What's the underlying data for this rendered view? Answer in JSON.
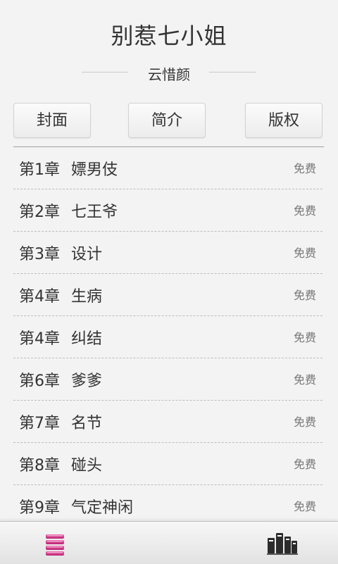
{
  "book": {
    "title": "别惹七小姐",
    "author": "云惜颜"
  },
  "buttons": {
    "cover": "封面",
    "intro": "简介",
    "copyright": "版权"
  },
  "chapters": [
    {
      "number": "第1章",
      "name": "嫖男伎",
      "price": "免费"
    },
    {
      "number": "第2章",
      "name": "七王爷",
      "price": "免费"
    },
    {
      "number": "第3章",
      "name": "设计",
      "price": "免费"
    },
    {
      "number": "第4章",
      "name": "生病",
      "price": "免费"
    },
    {
      "number": "第4章",
      "name": "纠结",
      "price": "免费"
    },
    {
      "number": "第6章",
      "name": "爹爹",
      "price": "免费"
    },
    {
      "number": "第7章",
      "name": "名节",
      "price": "免费"
    },
    {
      "number": "第8章",
      "name": "碰头",
      "price": "免费"
    },
    {
      "number": "第9章",
      "name": "气定神闲",
      "price": "免费"
    }
  ],
  "bottom_bar": {
    "left_icon": "table-of-contents-icon",
    "right_icon": "bookshelf-icon"
  },
  "colors": {
    "accent_pink": "#d6338c",
    "icon_dark": "#2b2b2b",
    "background": "#f3f3f3"
  }
}
